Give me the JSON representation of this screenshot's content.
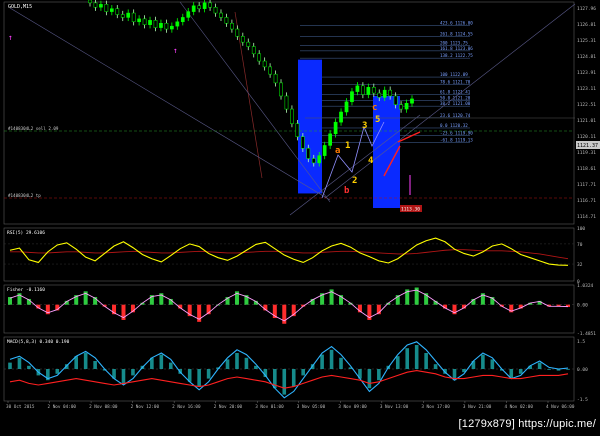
{
  "window": {
    "symbol_label": "GOLD,M15"
  },
  "watermark": "[1279x879] https://upic.me/",
  "colors": {
    "background": "#000000",
    "grid": "#1e1e1e",
    "axis": "#bbbbbb",
    "bull_candle": "#00ff00",
    "bear_candle": "#b4ffb4",
    "rsi_line": "#ffff00",
    "rsi_ma": "#b01515",
    "fisher_line": "#8b1a8b",
    "fisher_hist_pos": "#2ecc40",
    "fisher_hist_neg": "#ff2d2d",
    "macd_hist_pos": "#1aa3a3",
    "macd_line": "#2fb4ff",
    "macd_signal": "#ff2020",
    "fib_box": "#0a2aff",
    "wave_label": "#ffd000",
    "wave_label_alt": "#ff7a00"
  },
  "chart_data": [
    {
      "type": "line",
      "name": "price",
      "title": "GOLD,M15",
      "ylim": [
        1112.7,
        1127.96
      ],
      "yticks": [
        "1127.96",
        "1126.81",
        "1125.31",
        "1124.81",
        "1123.91",
        "1123.11",
        "1122.51",
        "1121.01",
        "1120.11",
        "1119.31",
        "1118.61",
        "1117.71",
        "1116.71",
        "1114.71"
      ],
      "note_left_1": "#1408304L2 sell 2.09",
      "note_left_2": "#1408304L2 tp",
      "price_tag": "1121.37",
      "price_tag_low": "1113.30",
      "fib_levels": [
        {
          "label": "423.6  1126.00",
          "value": 1126.36
        },
        {
          "label": "261.8  1124.55",
          "value": 1125.6
        },
        {
          "label": "200  1123.75",
          "value": 1124.97
        },
        {
          "label": "161.8  1123.06",
          "value": 1124.6
        },
        {
          "label": "138.2  1122.75",
          "value": 1124.1
        },
        {
          "label": "100  1122.09",
          "value": 1122.8
        },
        {
          "label": "78.6  1121.70",
          "value": 1122.3
        },
        {
          "label": "61.8  1121.41",
          "value": 1121.6
        },
        {
          "label": "50.0  1121.20",
          "value": 1121.2
        },
        {
          "label": "38.2  1121.00",
          "value": 1120.8
        },
        {
          "label": "23.6  1120.74",
          "value": 1120.0
        },
        {
          "label": "0.0  1120.32",
          "value": 1119.3
        },
        {
          "label": "-23.6  1119.90",
          "value": 1118.8
        },
        {
          "label": "-61.8  1119.13",
          "value": 1118.3
        }
      ],
      "close_series": [
        1127.9,
        1127.6,
        1127.8,
        1127.3,
        1127.5,
        1127.1,
        1126.9,
        1127.2,
        1126.6,
        1126.8,
        1126.4,
        1126.7,
        1126.2,
        1126.5,
        1126.1,
        1126.3,
        1126.6,
        1126.9,
        1127.3,
        1127.7,
        1127.5,
        1127.9,
        1127.6,
        1127.2,
        1126.9,
        1126.5,
        1126.1,
        1125.6,
        1125.2,
        1124.9,
        1124.4,
        1123.9,
        1123.5,
        1123.0,
        1122.4,
        1121.5,
        1120.6,
        1119.6,
        1118.7,
        1117.9,
        1117.2,
        1116.9,
        1117.4,
        1118.1,
        1118.9,
        1119.7,
        1120.4,
        1121.1,
        1121.8,
        1122.2,
        1121.6,
        1122.1,
        1121.7,
        1121.4,
        1121.9,
        1121.5,
        1120.9,
        1120.6,
        1121.0,
        1121.3
      ],
      "wave_labels": [
        "a",
        "b",
        "c",
        "1",
        "2",
        "3",
        "4",
        "5"
      ],
      "x_tick_labels": [
        "30 Oct 2015",
        "2 Nov 04:00",
        "2 Nov 08:00",
        "2 Nov 12:00",
        "2 Nov 16:00",
        "2 Nov 20:00",
        "3 Nov 01:00",
        "3 Nov 05:00",
        "3 Nov 09:00",
        "3 Nov 13:00",
        "3 Nov 17:00",
        "3 Nov 21:00",
        "4 Nov 02:00",
        "4 Nov 06:00"
      ]
    },
    {
      "type": "line",
      "name": "rsi",
      "label": "RSI(5) 29.6106",
      "ylim": [
        0,
        100
      ],
      "yticks": [
        "100",
        "70",
        "32",
        "0"
      ],
      "values": [
        58,
        62,
        40,
        35,
        55,
        68,
        72,
        60,
        45,
        38,
        52,
        66,
        74,
        63,
        50,
        42,
        36,
        48,
        61,
        70,
        65,
        52,
        44,
        39,
        47,
        58,
        69,
        73,
        61,
        49,
        41,
        35,
        44,
        57,
        66,
        71,
        64,
        53,
        46,
        38,
        34,
        42,
        55,
        68,
        76,
        81,
        74,
        60,
        52,
        47,
        55,
        66,
        70,
        61,
        50,
        44,
        38,
        32,
        30,
        29.6
      ],
      "ma_values": [
        55,
        55,
        54,
        53,
        53,
        54,
        55,
        55,
        54,
        53,
        53,
        54,
        55,
        56,
        55,
        54,
        53,
        53,
        54,
        55,
        56,
        55,
        54,
        53,
        53,
        54,
        55,
        56,
        56,
        55,
        54,
        53,
        53,
        54,
        55,
        56,
        56,
        55,
        54,
        53,
        52,
        51,
        51,
        52,
        54,
        56,
        58,
        59,
        59,
        58,
        57,
        57,
        57,
        56,
        55,
        53,
        51,
        48,
        45,
        42
      ]
    },
    {
      "type": "bar",
      "name": "fisher",
      "label": "Fisher -0.1160",
      "ylim": [
        -1.4851,
        1.0324
      ],
      "yticks": [
        "1.0324",
        "0.00",
        "-1.4851"
      ],
      "values": [
        0.4,
        0.6,
        0.3,
        -0.2,
        -0.5,
        -0.3,
        0.2,
        0.5,
        0.7,
        0.4,
        -0.1,
        -0.5,
        -0.8,
        -0.4,
        0.1,
        0.5,
        0.6,
        0.3,
        -0.2,
        -0.6,
        -0.9,
        -0.5,
        0.0,
        0.4,
        0.7,
        0.5,
        0.2,
        -0.3,
        -0.7,
        -1.0,
        -0.6,
        -0.1,
        0.3,
        0.6,
        0.8,
        0.5,
        0.1,
        -0.4,
        -0.8,
        -0.5,
        0.1,
        0.5,
        0.8,
        0.9,
        0.6,
        0.2,
        -0.2,
        -0.5,
        -0.2,
        0.3,
        0.6,
        0.4,
        -0.1,
        -0.4,
        -0.2,
        0.1,
        0.2,
        -0.1,
        -0.1,
        -0.12
      ]
    },
    {
      "type": "bar",
      "name": "macd",
      "label": "MACD(5,8,3) 0.340 0.190",
      "ylim": [
        -1.0,
        1.0
      ],
      "yticks": [
        "1.5",
        "0.00",
        "-1.5"
      ],
      "hist": [
        0.2,
        0.35,
        0.1,
        -0.2,
        -0.35,
        -0.15,
        0.15,
        0.4,
        0.5,
        0.25,
        -0.05,
        -0.3,
        -0.45,
        -0.2,
        0.1,
        0.35,
        0.45,
        0.2,
        -0.15,
        -0.4,
        -0.55,
        -0.3,
        0.05,
        0.3,
        0.5,
        0.35,
        0.1,
        -0.25,
        -0.6,
        -0.8,
        -0.55,
        -0.2,
        0.15,
        0.45,
        0.6,
        0.35,
        0.05,
        -0.3,
        -0.6,
        -0.35,
        0.1,
        0.4,
        0.65,
        0.75,
        0.5,
        0.15,
        -0.15,
        -0.35,
        -0.1,
        0.25,
        0.45,
        0.3,
        -0.05,
        -0.3,
        -0.15,
        0.1,
        0.2,
        0.0,
        -0.05,
        0.0
      ],
      "macd": [
        0.3,
        0.4,
        0.2,
        -0.1,
        -0.3,
        -0.2,
        0.1,
        0.4,
        0.55,
        0.35,
        0.0,
        -0.3,
        -0.5,
        -0.3,
        0.05,
        0.35,
        0.5,
        0.3,
        -0.1,
        -0.4,
        -0.65,
        -0.4,
        0.0,
        0.35,
        0.6,
        0.45,
        0.15,
        -0.2,
        -0.6,
        -0.9,
        -0.7,
        -0.3,
        0.1,
        0.5,
        0.7,
        0.45,
        0.1,
        -0.3,
        -0.7,
        -0.45,
        0.05,
        0.45,
        0.75,
        0.85,
        0.6,
        0.25,
        -0.1,
        -0.35,
        -0.15,
        0.25,
        0.5,
        0.35,
        0.0,
        -0.3,
        -0.2,
        0.1,
        0.25,
        0.05,
        0.0,
        0.03
      ],
      "signal": [
        -0.4,
        -0.35,
        -0.45,
        -0.5,
        -0.45,
        -0.4,
        -0.35,
        -0.3,
        -0.35,
        -0.4,
        -0.45,
        -0.5,
        -0.45,
        -0.4,
        -0.35,
        -0.3,
        -0.35,
        -0.4,
        -0.45,
        -0.5,
        -0.55,
        -0.5,
        -0.4,
        -0.3,
        -0.25,
        -0.3,
        -0.35,
        -0.4,
        -0.5,
        -0.6,
        -0.55,
        -0.45,
        -0.35,
        -0.25,
        -0.2,
        -0.25,
        -0.3,
        -0.35,
        -0.45,
        -0.4,
        -0.3,
        -0.2,
        -0.1,
        -0.05,
        -0.1,
        -0.15,
        -0.25,
        -0.3,
        -0.3,
        -0.25,
        -0.2,
        -0.2,
        -0.25,
        -0.3,
        -0.3,
        -0.25,
        -0.2,
        -0.2,
        -0.2,
        -0.15
      ]
    }
  ]
}
